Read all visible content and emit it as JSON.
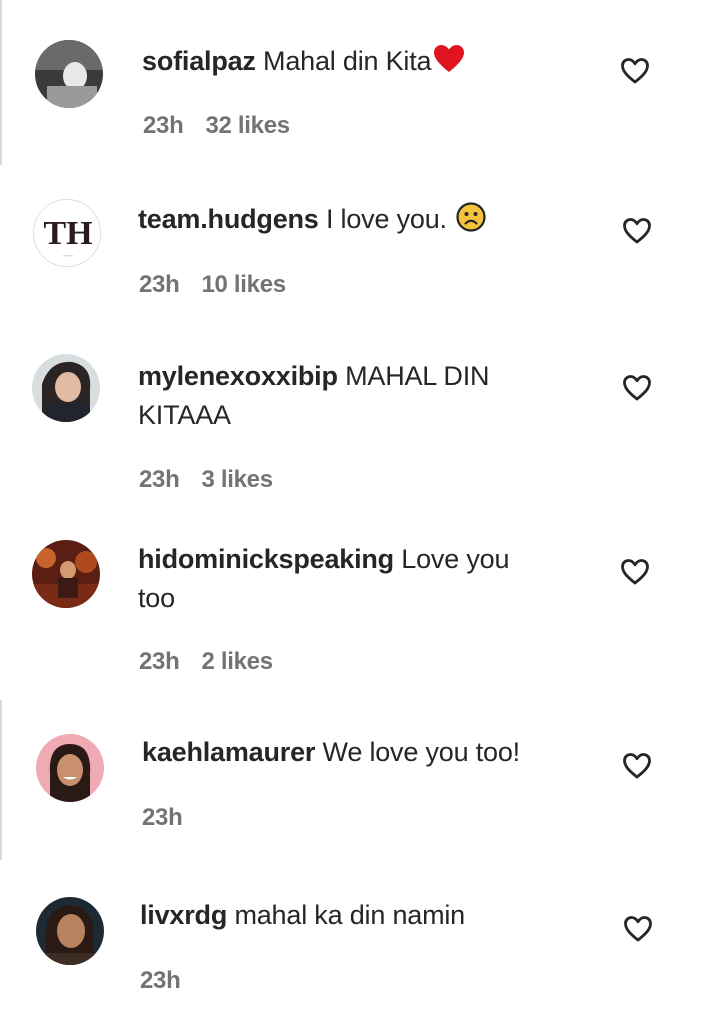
{
  "comments": [
    {
      "username": "sofialpaz",
      "text": "Mahal din Kita",
      "emoji": "red-heart",
      "time": "23h",
      "likes": "32 likes"
    },
    {
      "username": "team.hudgens",
      "text": "I love you.",
      "emoji": "frowning-face",
      "time": "23h",
      "likes": "10 likes"
    },
    {
      "username": "mylenexoxxibip",
      "text": "MAHAL DIN",
      "text_line2": "KITAAA",
      "time": "23h",
      "likes": "3 likes"
    },
    {
      "username": "hidominickspeaking",
      "text": "Love you",
      "text_line2": "too",
      "time": "23h",
      "likes": "2 likes"
    },
    {
      "username": "kaehlamaurer",
      "text": "We love you too!",
      "time": "23h"
    },
    {
      "username": "livxrdg",
      "text": "mahal ka din namin",
      "time": "23h"
    }
  ],
  "avatars": {
    "th_logo_text": "TH"
  },
  "icons": {
    "like": "heart-outline-icon",
    "emoji_heart": "red-heart",
    "emoji_frown": "frowning-face"
  },
  "colors": {
    "text": "#262626",
    "meta": "#737373",
    "heart_red": "#e0141e",
    "emoji_yellow": "#f5c33b"
  }
}
